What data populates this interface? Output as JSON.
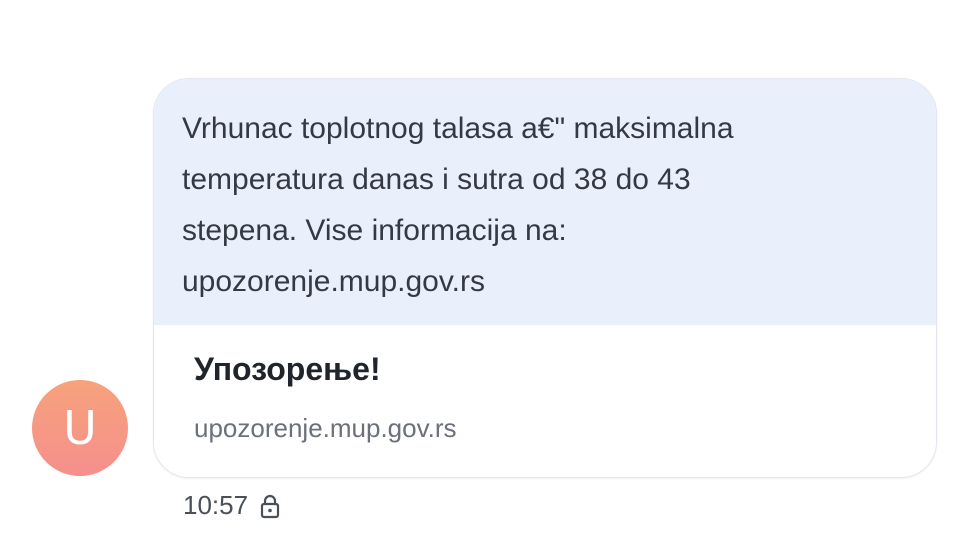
{
  "conversation": {
    "avatar": {
      "initial": "U",
      "gradient_top": "#f7a27c",
      "gradient_bottom": "#f58f8c"
    },
    "message": {
      "text": "Vrhunac toplotnog talasa a€\" maksimalna\ntemperatura danas i sutra od 38 do 43\nstepena. Vise informacija na:\nupozorenje.mup.gov.rs",
      "bubble_color": "#eaf0fb"
    },
    "link_preview": {
      "title": "Упозорење!",
      "domain": "upozorenje.mup.gov.rs"
    },
    "meta": {
      "time": "10:57",
      "icon": "lock-icon"
    }
  }
}
